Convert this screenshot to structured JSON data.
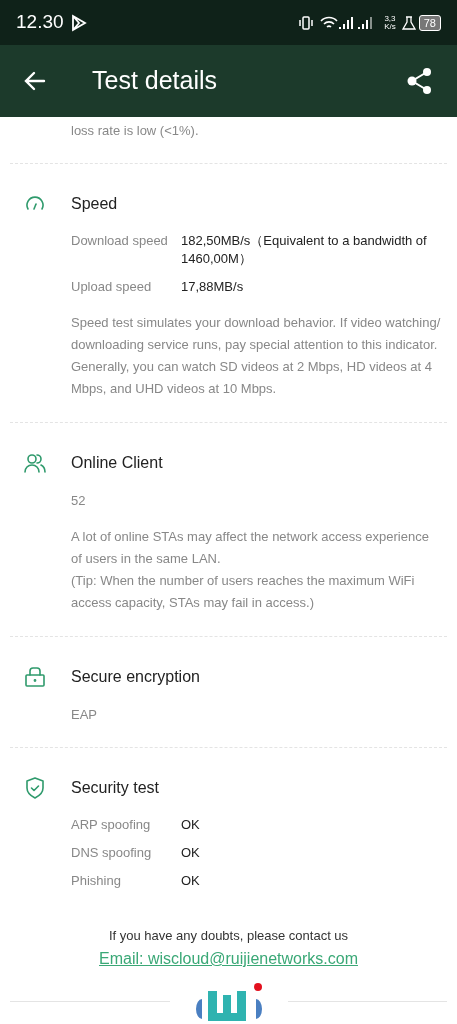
{
  "status_bar": {
    "time": "12.30",
    "net_speed": "3,3",
    "net_unit": "K/s",
    "battery": "78"
  },
  "header": {
    "title": "Test details"
  },
  "intro_tail": "loss rate is low (<1%).",
  "sections": [
    {
      "kind": "speed",
      "title": "Speed",
      "rows": [
        {
          "label": "Download speed",
          "value": "182,50MB/s（Equivalent to a bandwidth of 1460,00M）"
        },
        {
          "label": "Upload speed",
          "value": "17,88MB/s"
        }
      ],
      "notes": [
        "Speed test simulates your download behavior. If video watching/ downloading service runs, pay special attention to this indicator. Generally, you can watch SD videos at 2 Mbps, HD videos at 4 Mbps, and UHD videos at 10 Mbps."
      ]
    },
    {
      "kind": "clients",
      "title": "Online Client",
      "value": "52",
      "notes": [
        "A lot of online STAs may affect the network access experience of users in the same LAN.",
        "(Tip: When the number of users reaches the maximum WiFi access capacity, STAs may fail in access.)"
      ]
    },
    {
      "kind": "lock",
      "title": "Secure encryption",
      "value": "EAP"
    },
    {
      "kind": "shield",
      "title": "Security test",
      "rows": [
        {
          "label": "ARP spoofing",
          "value": "OK"
        },
        {
          "label": "DNS spoofing",
          "value": "OK"
        },
        {
          "label": "Phishing",
          "value": "OK"
        }
      ]
    }
  ],
  "footer": {
    "question": "If you have any doubts, please contact us",
    "email": "Email: wiscloud@ruijienetworks.com"
  }
}
